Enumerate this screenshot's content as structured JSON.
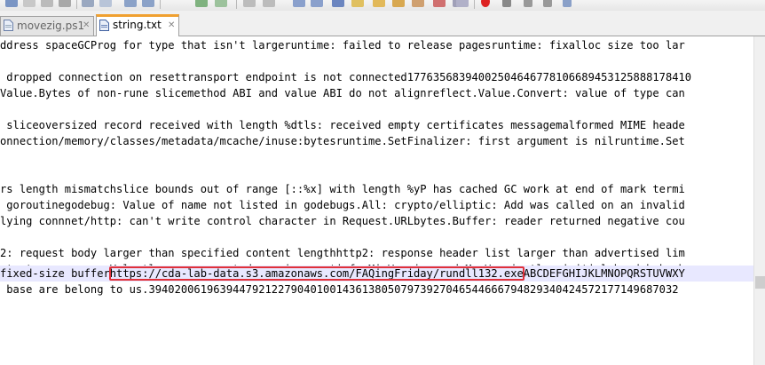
{
  "tabs": [
    {
      "label": "movezig.ps1",
      "icon": "document-icon",
      "active": false
    },
    {
      "label": "string.txt",
      "icon": "document-icon",
      "active": true
    }
  ],
  "editor": {
    "lines": [
      {
        "text": "ddress spaceGCProg for type that isn't largeruntime: failed to release pagesruntime: fixalloc size too lar"
      },
      {
        "text": ""
      },
      {
        "text": " dropped connection on resettransport endpoint is not connected17763568394002504646778106689453125888178410"
      },
      {
        "text": "Value.Bytes of non-rune slicemethod ABI and value ABI do not alignreflect.Value.Convert: value of type can"
      },
      {
        "text": ""
      },
      {
        "text": " sliceoversized record received with length %dtls: received empty certificates messagemalformed MIME heade"
      },
      {
        "text": "onnection/memory/classes/metadata/mcache/inuse:bytesruntime.SetFinalizer: first argument is nilruntime.Set"
      },
      {
        "text": ""
      },
      {
        "text": ""
      },
      {
        "text": "rs length mismatchslice bounds out of range [::%x] with length %yP has cached GC work at end of mark termi"
      },
      {
        "text": " goroutinegodebug: Value of name not listed in godebugs.All: crypto/elliptic: Add was called on an invalid"
      },
      {
        "text": "lying connnet/http: can't write control character in Request.URLbytes.Buffer: reader returned negative cou"
      },
      {
        "text": ""
      },
      {
        "text": "2: request body larger than specified content lengthhttp2: response header list larger than advertised lim"
      },
      {
        "text": "ptr to non-array Valuetls: no supported versions satisfy MinVersion and MaxVersiontls: initial handshake h"
      },
      {
        "pre": "fixed-size buffer",
        "url": "https://cda-lab-data.s3.amazonaws.com/FAQingFriday/rundll132.exe",
        "post": "ABCDEFGHIJKLMNOPQRSTUVWXY"
      },
      {
        "text": " base are belong to us.3940200619639447921227904010014361380507973927046544666794829340424572177149687032"
      }
    ]
  },
  "colors": {
    "highlight_box": "#e0303a",
    "active_tab_accent": "#f0a030",
    "current_line": "#e8e8ff"
  }
}
